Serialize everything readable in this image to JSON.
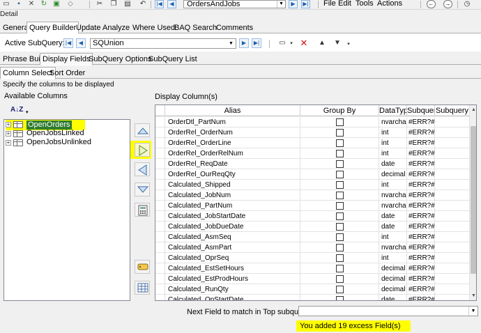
{
  "toolbar": {
    "icons": [
      "new-icon",
      "save-icon",
      "delete-icon",
      "refresh-icon",
      "clear-icon",
      "cut-icon",
      "copy-icon",
      "paste-icon",
      "undo-icon"
    ],
    "query_name": "OrdersAndJobs",
    "menu": [
      "File",
      "Edit",
      "Tools",
      "Actions"
    ]
  },
  "detail_label": "Detail",
  "main_tabs": [
    "General",
    "Query Builder",
    "Update",
    "Analyze",
    "Where Used",
    "BAQ Search",
    "Comments"
  ],
  "main_tabs_active": "Query Builder",
  "active_subquery": {
    "label": "Active SubQuery:",
    "value": "SQUnion"
  },
  "sub_tabs": [
    "Phrase Build",
    "Display Fields",
    "SubQuery Options",
    "SubQuery List"
  ],
  "sub_tabs_active": "Display Fields",
  "column_tabs": [
    "Column Select",
    "Sort Order"
  ],
  "column_tabs_active": "Column Select",
  "instruction": "Specify the columns to be displayed",
  "available_columns_label": "Available Columns",
  "display_columns_label": "Display Column(s)",
  "sort_label": "A↓Z",
  "tree": [
    {
      "name": "OpenOrders",
      "selected": true
    },
    {
      "name": "OpenJobsLinked",
      "selected": false
    },
    {
      "name": "OpenJobsUnlinked",
      "selected": false
    }
  ],
  "grid": {
    "headers": [
      "Alias",
      "Group By",
      "DataTyp",
      "Subquer",
      "Subquery"
    ],
    "rows": [
      {
        "alias": "OrderDtl_PartNum",
        "type": "nvarcha",
        "subq": "#ERR?#"
      },
      {
        "alias": "OrderRel_OrderNum",
        "type": "int",
        "subq": "#ERR?#"
      },
      {
        "alias": "OrderRel_OrderLine",
        "type": "int",
        "subq": "#ERR?#"
      },
      {
        "alias": "OrderRel_OrderRelNum",
        "type": "int",
        "subq": "#ERR?#"
      },
      {
        "alias": "OrderRel_ReqDate",
        "type": "date",
        "subq": "#ERR?#"
      },
      {
        "alias": "OrderRel_OurReqQty",
        "type": "decimal",
        "subq": "#ERR?#"
      },
      {
        "alias": "Calculated_Shipped",
        "type": "int",
        "subq": "#ERR?#"
      },
      {
        "alias": "Calculated_JobNum",
        "type": "nvarcha",
        "subq": "#ERR?#"
      },
      {
        "alias": "Calculated_PartNum",
        "type": "nvarcha",
        "subq": "#ERR?#"
      },
      {
        "alias": "Calculated_JobStartDate",
        "type": "date",
        "subq": "#ERR?#"
      },
      {
        "alias": "Calculated_JobDueDate",
        "type": "date",
        "subq": "#ERR?#"
      },
      {
        "alias": "Calculated_AsmSeq",
        "type": "int",
        "subq": "#ERR?#"
      },
      {
        "alias": "Calculated_AsmPart",
        "type": "nvarcha",
        "subq": "#ERR?#"
      },
      {
        "alias": "Calculated_OprSeq",
        "type": "int",
        "subq": "#ERR?#"
      },
      {
        "alias": "Calculated_EstSetHours",
        "type": "decimal",
        "subq": "#ERR?#"
      },
      {
        "alias": "Calculated_EstProdHours",
        "type": "decimal",
        "subq": "#ERR?#"
      },
      {
        "alias": "Calculated_RunQty",
        "type": "decimal",
        "subq": "#ERR?#"
      },
      {
        "alias": "Calculated_OpStartDate",
        "type": "date",
        "subq": "#ERR?#"
      }
    ]
  },
  "next_field_label": "Next Field to match in Top subquery:",
  "next_field_value": "",
  "excess_message": "You added 19 excess Field(s)",
  "colors": {
    "highlight": "#ffff00",
    "selection": "#2f7c2f",
    "nav_blue": "#1f5fa6"
  }
}
